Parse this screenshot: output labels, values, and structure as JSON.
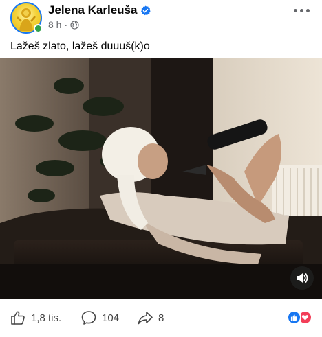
{
  "post": {
    "author_name": "Jelena Karleuša",
    "time": "8 h",
    "time_separator": "·",
    "caption": "Lažeš zlato, lažeš duuuš(k)o"
  },
  "engagement": {
    "likes": "1,8 tis.",
    "comments": "104",
    "shares": "8"
  },
  "icons": {
    "verified": "verified-badge-icon",
    "audience": "globe-icon",
    "more": "more-options-icon",
    "like": "thumbs-up-icon",
    "comment": "comment-bubble-icon",
    "share": "share-arrow-icon",
    "mute": "speaker-icon",
    "reaction_like": "like-reaction-icon",
    "reaction_love": "love-reaction-icon"
  },
  "colors": {
    "brand_blue": "#1877f2",
    "online_green": "#31a24c",
    "love_red": "#f33e58",
    "secondary_text": "#65676b"
  }
}
